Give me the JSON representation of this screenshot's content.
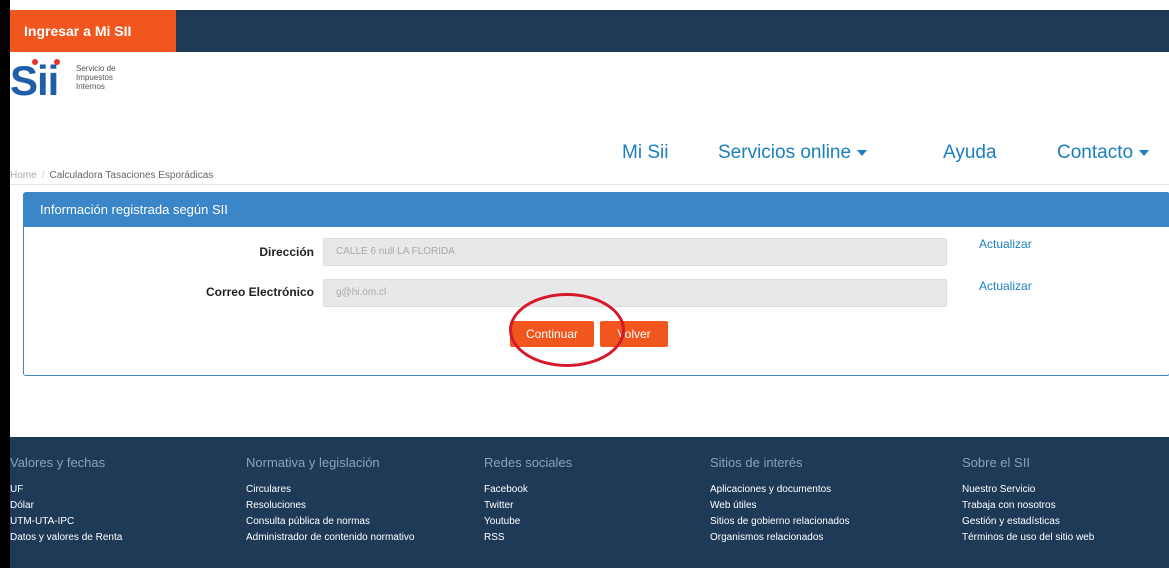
{
  "topbar": {
    "login_label": "Ingresar a Mi SII"
  },
  "logo": {
    "mark": "Sii",
    "line1": "Servicio de",
    "line2": "Impuestos",
    "line3": "Internos"
  },
  "nav": {
    "items": [
      {
        "label": "Mi Sii",
        "dropdown": false
      },
      {
        "label": "Servicios online",
        "dropdown": true
      },
      {
        "label": "Ayuda",
        "dropdown": false
      },
      {
        "label": "Contacto",
        "dropdown": true
      }
    ]
  },
  "breadcrumb": {
    "home": "Home",
    "current": "Calculadora Tasaciones Esporádicas"
  },
  "panel": {
    "title": "Información registrada según SII",
    "rows": [
      {
        "label": "Dirección",
        "value": "CALLE 6 null LA FLORIDA",
        "action": "Actualizar"
      },
      {
        "label": "Correo Electrónico",
        "value": "g@hi.om.cl",
        "action": "Actualizar"
      }
    ],
    "continue_label": "Continuar",
    "back_label": "Volver"
  },
  "footer": {
    "columns": [
      {
        "title": "Valores y fechas",
        "items": [
          "UF",
          "Dólar",
          "UTM-UTA-IPC",
          "Datos y valores de Renta"
        ]
      },
      {
        "title": "Normativa y legislación",
        "items": [
          "Circulares",
          "Resoluciones",
          "Consulta pública de normas",
          "Administrador de contenido normativo"
        ]
      },
      {
        "title": "Redes sociales",
        "items": [
          "Facebook",
          "Twitter",
          "Youtube",
          "RSS"
        ]
      },
      {
        "title": "Sitios de interés",
        "items": [
          "Aplicaciones y documentos",
          "Web útiles",
          "Sitios de gobierno relacionados",
          "Organismos relacionados"
        ]
      },
      {
        "title": "Sobre el SII",
        "items": [
          "Nuestro Servicio",
          "Trabaja con nosotros",
          "Gestión y estadísticas",
          "Términos de uso del sitio web"
        ]
      }
    ]
  },
  "colors": {
    "navy": "#1f3a57",
    "orange": "#f0561d",
    "blue": "#3a86c8",
    "link": "#1a7fc0",
    "highlight_circle": "#d7182a"
  }
}
